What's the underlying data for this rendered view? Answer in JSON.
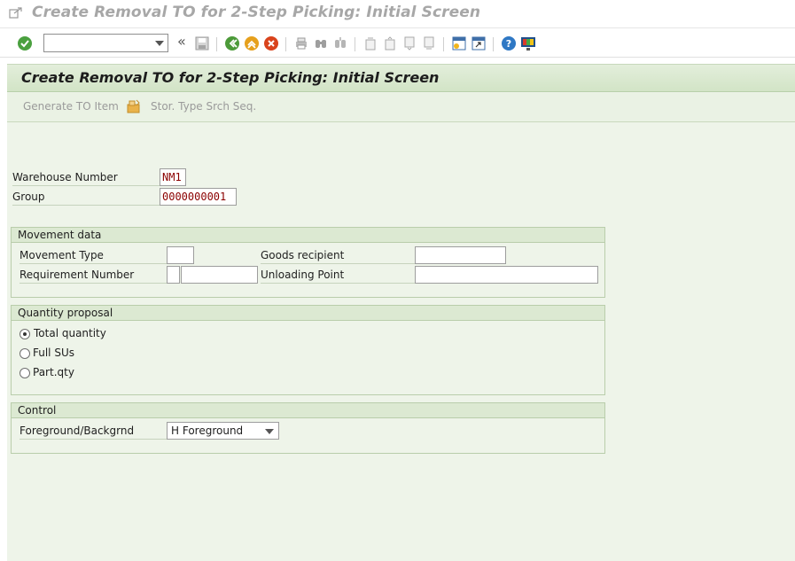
{
  "window": {
    "title": "Create Removal TO for 2-Step Picking: Initial Screen"
  },
  "toolbar": {
    "command_field_value": "",
    "icons": [
      "enter-icon",
      "save-icon",
      "back-icon",
      "exit-icon",
      "cancel-icon",
      "print-icon",
      "find-icon",
      "find-next-icon",
      "first-page-icon",
      "previous-page-icon",
      "next-page-icon",
      "last-page-icon",
      "new-session-icon",
      "shortcut-icon",
      "help-icon",
      "customize-layout-icon"
    ]
  },
  "screen": {
    "title": "Create Removal TO for 2-Step Picking: Initial Screen",
    "buttons": {
      "generate_to_item": "Generate TO Item",
      "stor_type_srch_seq": "Stor. Type Srch Seq."
    }
  },
  "header_fields": {
    "warehouse_number_label": "Warehouse Number",
    "warehouse_number_value": "NM1",
    "group_label": "Group",
    "group_value": "0000000001"
  },
  "movement_data": {
    "title": "Movement data",
    "movement_type_label": "Movement Type",
    "movement_type_value": "",
    "requirement_number_label": "Requirement Number",
    "requirement_type_value": "",
    "requirement_number_value": "",
    "goods_recipient_label": "Goods recipient",
    "goods_recipient_value": "",
    "unloading_point_label": "Unloading Point",
    "unloading_point_value": ""
  },
  "quantity_proposal": {
    "title": "Quantity proposal",
    "options": [
      {
        "label": "Total quantity",
        "selected": true
      },
      {
        "label": "Full SUs",
        "selected": false
      },
      {
        "label": "Part.qty",
        "selected": false
      }
    ]
  },
  "control": {
    "title": "Control",
    "foreground_label": "Foreground/Backgrnd",
    "foreground_value": "H Foreground"
  },
  "colors": {
    "canvas": "#eef4e9",
    "header": "#d2e4c6",
    "value_text": "#8b0000"
  }
}
